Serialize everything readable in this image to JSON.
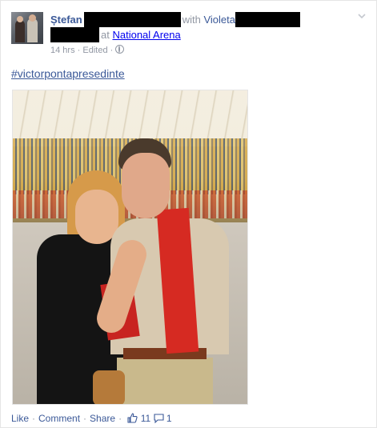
{
  "post": {
    "author": "Ștefan",
    "with_text": "with",
    "tagged": "Violeta",
    "at_text": "at",
    "location": "National Arena",
    "timestamp": "14 hrs",
    "edited": "Edited",
    "meta_sep": "·",
    "hashtag": "#victorpontapresedinte"
  },
  "actions": {
    "like": "Like",
    "comment": "Comment",
    "share": "Share",
    "like_count": "11",
    "comment_count": "1",
    "sep": "·"
  },
  "icons": {
    "privacy": "globe-icon",
    "options": "chevron-down-icon",
    "likes": "thumbs-up-icon",
    "comments": "speech-bubble-icon"
  },
  "colors": {
    "link": "#3b5998",
    "meta": "#9197a3"
  }
}
